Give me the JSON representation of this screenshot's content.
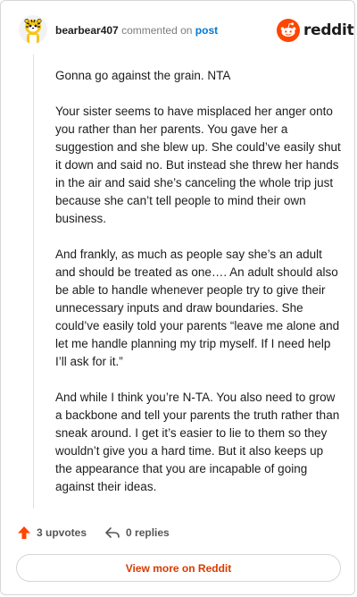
{
  "header": {
    "username": "bearbear407",
    "action_text": "commented on",
    "post_link": "post",
    "brand": "reddit",
    "avatar_icon": "tiger-snoo-avatar-icon",
    "brand_color": "#ff4500"
  },
  "comment": {
    "paragraphs": [
      "Gonna go against the grain. NTA",
      "Your sister seems to have misplaced her anger onto you rather than her parents. You gave her a suggestion and she blew up. She could’ve easily shut it down and said no. But instead she threw her hands in the air and said she’s canceling the whole trip just because she can’t tell people to mind their own business.",
      "And frankly, as much as people say she’s an adult and should be treated as one…. An adult should also be able to handle whenever people try to give their unnecessary inputs and draw boundaries. She could’ve easily told your parents “leave me alone and let me handle planning my trip myself. If I need help I’ll ask for it.”",
      "And while I think you’re N-TA. You also need to grow a backbone and tell your parents the truth rather than sneak around. I get it’s easier to lie to them so they wouldn’t give you a hard time. But it also keeps up the appearance that you are incapable of going against their ideas."
    ]
  },
  "footer": {
    "upvotes": "3 upvotes",
    "replies": "0 replies",
    "view_more": "View more on Reddit",
    "upvote_color": "#ff4500",
    "view_more_color": "#d93a00"
  }
}
